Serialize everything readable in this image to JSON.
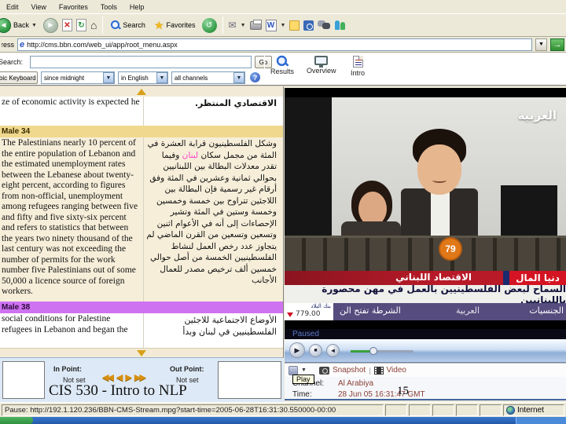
{
  "window": {
    "menu": [
      "Edit",
      "View",
      "Favorites",
      "Tools",
      "Help"
    ],
    "toolbar": {
      "back": "Back",
      "search": "Search",
      "favorites": "Favorites"
    },
    "address": {
      "label": "Address",
      "url": "http://cms.bbn.com/web_ui/app/root_menu.aspx"
    }
  },
  "search_bar": {
    "label": "Search:",
    "value": "",
    "go": "Go",
    "keyboard": "Arabic Keyboard",
    "time_range": "since midnight",
    "language": "in English",
    "channels": "all channels"
  },
  "nav": {
    "results": "Results",
    "overview": "Overview",
    "intro": "Intro"
  },
  "transcript": {
    "row_a": {
      "en": "ze of economic activity is expected he",
      "ar": "الاقتصادي المنتظر."
    },
    "header_34": "Male 34",
    "row_b": {
      "en": "The Palestinians nearly 10 percent of the entire population of Lebanon and the estimated unemployment rates between the Lebanese about twenty-eight percent, according to figures from non-official, unemployment among refugees ranging between five and fifty and five sixty-six percent and refers to statistics that between the years two ninety thousand of the last century was not exceeding the number of permits for the work number five Palestinians out of some 50,000 a licence source of foreign workers.",
      "ar_before": "وشكل الفلسطينيون قرابة العشرة في المئة من مجمل سكان ",
      "ar_highlight": "لبنان",
      "ar_after": " وفيما تقدر معدلات البطالة بين اللبنانيين بحوالي ثمانية وعشرين في المئة وفق أرقام غير رسمية فإن البطالة بين اللاجئين تتراوح بين خمسة وخمسين وخمسة وستين في المئة وتشير الإحصاءات إلى أنه في الأعوام اثنين وتسعين وتسعين من القرن الماضي لم يتجاوز عدد رخص العمل لنشاط الفلسطينيين الخمسة من أصل حوالي خمسين ألف ترخيص مصدر للعمال الأجانب"
    },
    "header_38": "Male 38",
    "row_c": {
      "en": "social conditions for Palestine refugees in Lebanon and began the",
      "ar": "الأوضاع الاجتماعية للاجئين الفلسطينيين في لبنان وبدأ"
    }
  },
  "clip": {
    "in_label": "In Point:",
    "in_value": "Not set",
    "out_label": "Out Point:",
    "out_value": "Not set"
  },
  "video": {
    "channel_logo": "العربية",
    "jersey_number": "79",
    "banner_title": "الاقتصاد اللبناني",
    "banner_section": "دنيا المال",
    "caption": "السماح لبعض الفلسطينيين بالعمل في مهن محصورة باللبنانيين",
    "stock_name": "بنك البلاد",
    "stock_value": "779.00",
    "ticker_left": "الشرطة تفتح الن",
    "ticker_logo": "العربية",
    "ticker_right": "الجنسيات"
  },
  "player": {
    "status": "Paused",
    "tooltip": "Play",
    "snapshot": "Snapshot",
    "video_link": "Video",
    "channel_label": "Channel:",
    "channel_value": "Al Arabiya",
    "time_label": "Time:",
    "time_value": "28 Jun 05 16:31:47 GMT"
  },
  "status_bar": {
    "message": "Pause: http://192.1.120.236/BBN-CMS-Stream.mpg?start-time=2005-06-28T16:31:30.550000-00:00",
    "zone": "Internet"
  },
  "slide": {
    "title": "CIS 530 - Intro to NLP",
    "page": "15"
  },
  "colors": {
    "banner_red": "#b81a28",
    "ticker_purple": "#564c7e",
    "header_gold": "#f0d98e",
    "header_purple": "#ce72f2",
    "row_cream": "#f6eed9",
    "highlight_pink": "#ff46c8",
    "accent_orange": "#e07818"
  }
}
